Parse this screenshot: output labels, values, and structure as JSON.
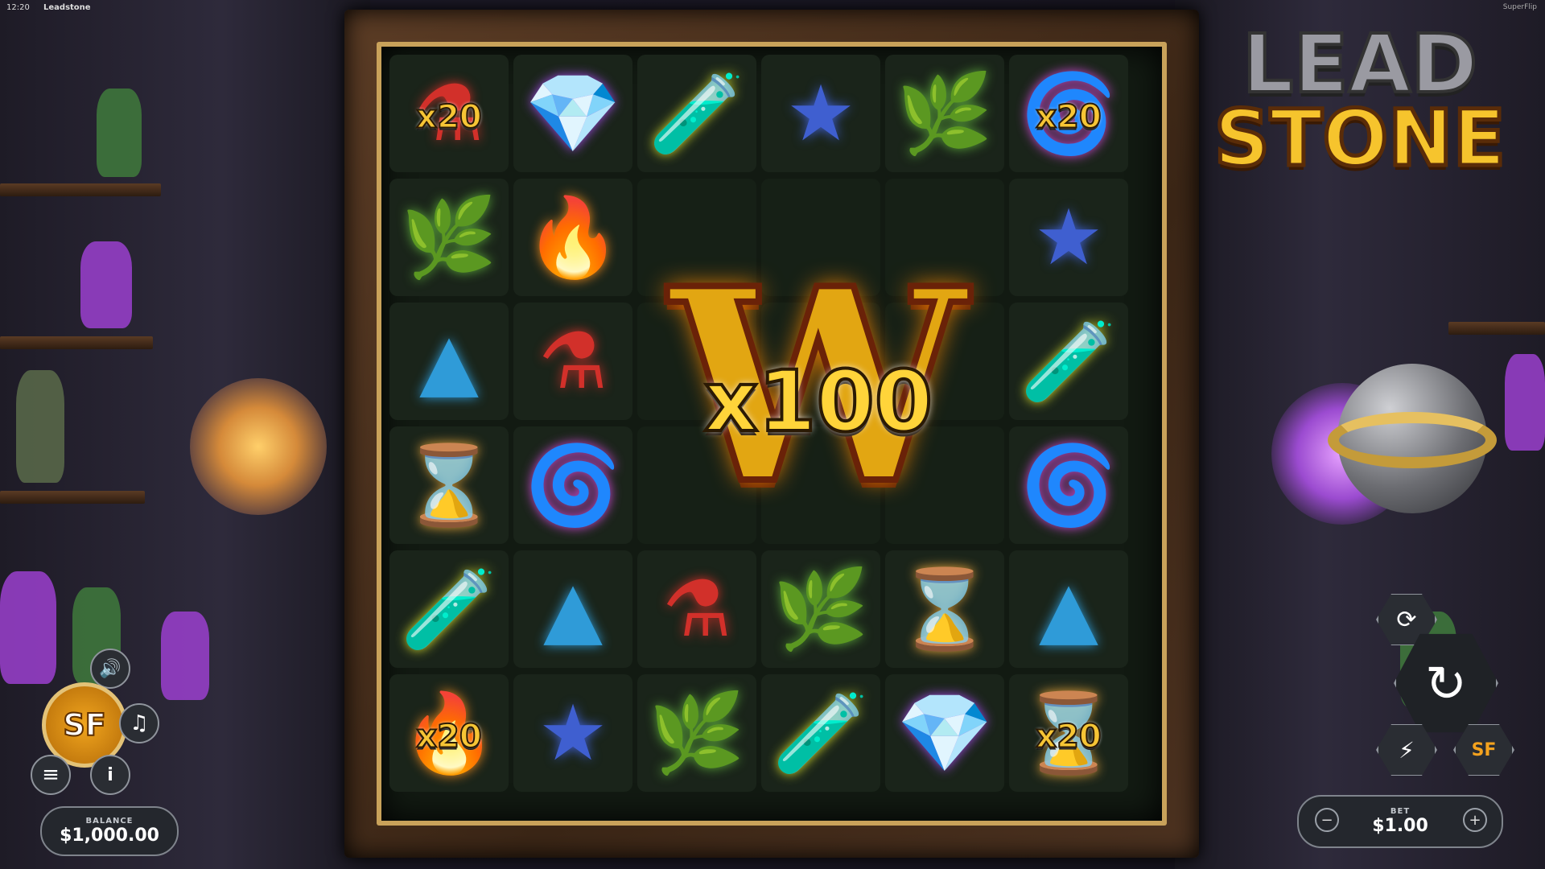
{
  "status_bar": {
    "time": "12:20",
    "game_name": "Leadstone",
    "provider": "SuperFlip"
  },
  "logo": {
    "line1": "LEAD",
    "line2": "STONE"
  },
  "grid": {
    "rows": 6,
    "cols": 6,
    "cells": [
      [
        {
          "symbol": "red-potion-icon",
          "glyph": "⚗",
          "color": "#d2302a",
          "multiplier": "x20"
        },
        {
          "symbol": "purple-crystal-icon",
          "glyph": "💎",
          "color": "#a24ae8",
          "multiplier": ""
        },
        {
          "symbol": "yellow-test-tube-icon",
          "glyph": "🧪",
          "color": "#d7e02f",
          "multiplier": ""
        },
        {
          "symbol": "blue-star-icon",
          "glyph": "★",
          "color": "#3f5fd0",
          "multiplier": ""
        },
        {
          "symbol": "mandrake-root-icon",
          "glyph": "🌿",
          "color": "#5aa43a",
          "multiplier": ""
        },
        {
          "symbol": "pink-coil-icon",
          "glyph": "🌀",
          "color": "#d24ad8",
          "multiplier": "x20"
        }
      ],
      [
        {
          "symbol": "mandrake-root-icon",
          "glyph": "🌿",
          "color": "#5aa43a",
          "multiplier": ""
        },
        {
          "symbol": "fire-cauldron-icon",
          "glyph": "🔥",
          "color": "#f08a1e",
          "multiplier": ""
        },
        {
          "symbol": "wild",
          "glyph": "",
          "color": "",
          "multiplier": ""
        },
        {
          "symbol": "wild",
          "glyph": "",
          "color": "",
          "multiplier": ""
        },
        {
          "symbol": "wild",
          "glyph": "",
          "color": "",
          "multiplier": ""
        },
        {
          "symbol": "blue-star-icon",
          "glyph": "★",
          "color": "#3f5fd0",
          "multiplier": ""
        }
      ],
      [
        {
          "symbol": "blue-flask-icon",
          "glyph": "▲",
          "color": "#2f9bd8",
          "multiplier": ""
        },
        {
          "symbol": "red-potion-icon",
          "glyph": "⚗",
          "color": "#d2302a",
          "multiplier": ""
        },
        {
          "symbol": "wild",
          "glyph": "",
          "color": "",
          "multiplier": ""
        },
        {
          "symbol": "wild",
          "glyph": "",
          "color": "",
          "multiplier": ""
        },
        {
          "symbol": "wild",
          "glyph": "",
          "color": "",
          "multiplier": ""
        },
        {
          "symbol": "yellow-test-tube-icon",
          "glyph": "🧪",
          "color": "#d7e02f",
          "multiplier": ""
        }
      ],
      [
        {
          "symbol": "hourglass-icon",
          "glyph": "⌛",
          "color": "#e3a23a",
          "multiplier": ""
        },
        {
          "symbol": "pink-coil-icon",
          "glyph": "🌀",
          "color": "#d24ad8",
          "multiplier": ""
        },
        {
          "symbol": "wild",
          "glyph": "",
          "color": "",
          "multiplier": ""
        },
        {
          "symbol": "wild",
          "glyph": "",
          "color": "",
          "multiplier": ""
        },
        {
          "symbol": "wild",
          "glyph": "",
          "color": "",
          "multiplier": ""
        },
        {
          "symbol": "pink-coil-icon",
          "glyph": "🌀",
          "color": "#d24ad8",
          "multiplier": ""
        }
      ],
      [
        {
          "symbol": "yellow-test-tube-icon",
          "glyph": "🧪",
          "color": "#d7e02f",
          "multiplier": ""
        },
        {
          "symbol": "blue-flask-icon",
          "glyph": "▲",
          "color": "#2f9bd8",
          "multiplier": ""
        },
        {
          "symbol": "red-potion-icon",
          "glyph": "⚗",
          "color": "#d2302a",
          "multiplier": ""
        },
        {
          "symbol": "mandrake-root-icon",
          "glyph": "🌿",
          "color": "#5aa43a",
          "multiplier": ""
        },
        {
          "symbol": "hourglass-icon",
          "glyph": "⌛",
          "color": "#e3a23a",
          "multiplier": ""
        },
        {
          "symbol": "blue-flask-icon",
          "glyph": "▲",
          "color": "#2f9bd8",
          "multiplier": ""
        }
      ],
      [
        {
          "symbol": "fire-cauldron-icon",
          "glyph": "🔥",
          "color": "#f08a1e",
          "multiplier": "x20"
        },
        {
          "symbol": "blue-star-icon",
          "glyph": "★",
          "color": "#3f5fd0",
          "multiplier": ""
        },
        {
          "symbol": "mandrake-root-icon",
          "glyph": "🌿",
          "color": "#5aa43a",
          "multiplier": ""
        },
        {
          "symbol": "yellow-test-tube-icon",
          "glyph": "🧪",
          "color": "#d7e02f",
          "multiplier": ""
        },
        {
          "symbol": "purple-crystal-icon",
          "glyph": "💎",
          "color": "#a24ae8",
          "multiplier": ""
        },
        {
          "symbol": "hourglass-icon",
          "glyph": "⌛",
          "color": "#e3a23a",
          "multiplier": "x20"
        }
      ]
    ]
  },
  "wild_symbol": {
    "letter": "W",
    "multiplier": "x100"
  },
  "controls": {
    "balance_label": "BALANCE",
    "balance_value": "$1,000.00",
    "bet_label": "BET",
    "bet_value": "$1.00",
    "sf_badge": "SF",
    "minus": "−",
    "plus": "+",
    "sound_glyph": "🔊",
    "music_glyph": "♫",
    "menu_glyph": "≡",
    "info_glyph": "i",
    "autoplay_glyph": "⟳",
    "spin_glyph": "↻",
    "turbo_glyph": "⚡",
    "superflip_glyph": "SF"
  }
}
